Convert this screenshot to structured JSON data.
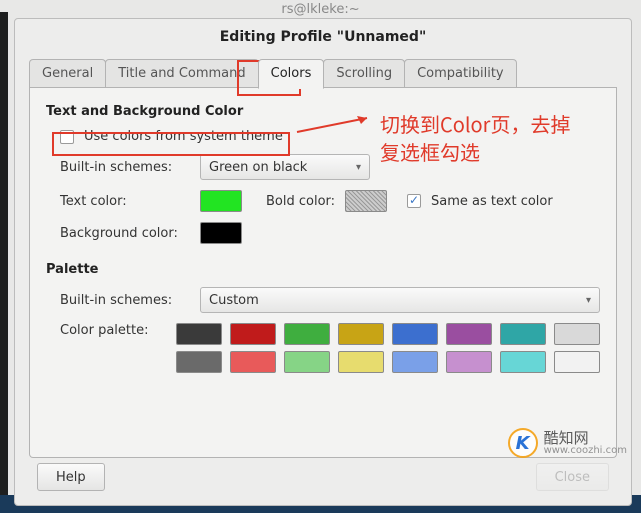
{
  "titlebar_hint": "rs@lkleke:~",
  "window_title": "Editing Profile \"Unnamed\"",
  "tabs": {
    "general": "General",
    "title_command": "Title and Command",
    "colors": "Colors",
    "scrolling": "Scrolling",
    "compatibility": "Compatibility"
  },
  "section": {
    "text_bg": "Text and Background Color",
    "palette": "Palette"
  },
  "fields": {
    "use_system_colors": "Use colors from system theme",
    "builtin_schemes": "Built-in schemes:",
    "text_color": "Text color:",
    "bold_color": "Bold color:",
    "same_as_text": "Same as text color",
    "background_color": "Background color:",
    "color_palette": "Color palette:"
  },
  "values": {
    "scheme": "Green on black",
    "palette_scheme": "Custom"
  },
  "buttons": {
    "help": "Help",
    "close": "Close"
  },
  "colors": {
    "text": "#22e422",
    "bold_hatched": true,
    "background": "#000000",
    "palette_row1": [
      "#3a3a3a",
      "#c01b1b",
      "#3fae3f",
      "#c8a415",
      "#3c6fcf",
      "#9a4ea0",
      "#2fa6a6",
      "#d9d9d9"
    ],
    "palette_row2": [
      "#6a6a6a",
      "#e85a5a",
      "#86d486",
      "#e7dc6e",
      "#7aa0e8",
      "#c690cf",
      "#67d6d6",
      "#f2f2f2"
    ]
  },
  "annotation": {
    "line1": "切换到Color页，去掉",
    "line2": "复选框勾选"
  },
  "watermark": {
    "k": "K",
    "cn": "酷知网",
    "url": "www.coozhi.com"
  }
}
